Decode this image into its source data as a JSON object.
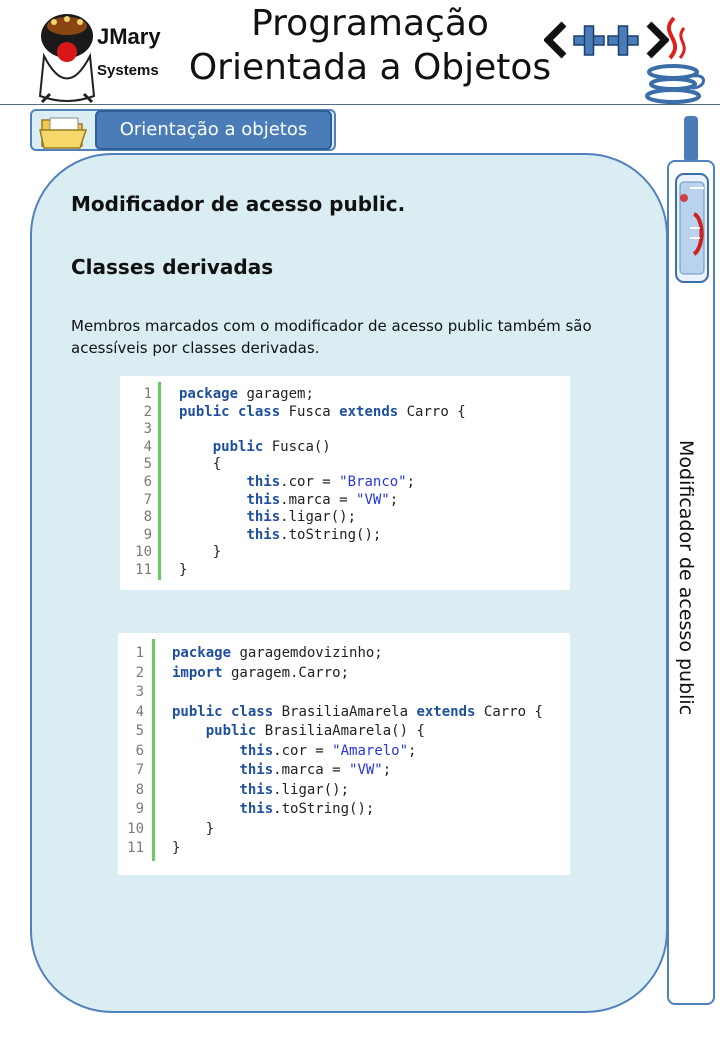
{
  "header": {
    "logo_name": "JMary",
    "logo_sub": "Systems",
    "title_line1": "Programação",
    "title_line2": "Orientada a Objetos",
    "cpp_logo": "<++>"
  },
  "tab": {
    "label": "Orientação a objetos"
  },
  "content": {
    "heading1": "Modificador de acesso public.",
    "heading2": "Classes derivadas",
    "paragraph": "Membros marcados com o modificador de acesso public também são acessíveis por classes derivadas."
  },
  "sidebar": {
    "vertical_title": "Modificador de acesso public"
  },
  "code_blocks": [
    {
      "lines": [
        [
          [
            "kw",
            "package"
          ],
          [
            "tx",
            " garagem;"
          ]
        ],
        [
          [
            "kw",
            "public class"
          ],
          [
            "tx",
            " Fusca "
          ],
          [
            "kw",
            "extends"
          ],
          [
            "tx",
            " Carro {"
          ]
        ],
        [],
        [
          [
            "tx",
            "    "
          ],
          [
            "kw",
            "public"
          ],
          [
            "tx",
            " Fusca()"
          ]
        ],
        [
          [
            "tx",
            "    {"
          ]
        ],
        [
          [
            "tx",
            "        "
          ],
          [
            "kw",
            "this"
          ],
          [
            "tx",
            ".cor = "
          ],
          [
            "str",
            "\"Branco\""
          ],
          [
            "tx",
            ";"
          ]
        ],
        [
          [
            "tx",
            "        "
          ],
          [
            "kw",
            "this"
          ],
          [
            "tx",
            ".marca = "
          ],
          [
            "str",
            "\"VW\""
          ],
          [
            "tx",
            ";"
          ]
        ],
        [
          [
            "tx",
            "        "
          ],
          [
            "kw",
            "this"
          ],
          [
            "tx",
            ".ligar();"
          ]
        ],
        [
          [
            "tx",
            "        "
          ],
          [
            "kw",
            "this"
          ],
          [
            "tx",
            ".toString();"
          ]
        ],
        [
          [
            "tx",
            "    }"
          ]
        ],
        [
          [
            "tx",
            "}"
          ]
        ]
      ]
    },
    {
      "lines": [
        [
          [
            "kw",
            "package"
          ],
          [
            "tx",
            " garagemdovizinho;"
          ]
        ],
        [
          [
            "kw",
            "import"
          ],
          [
            "tx",
            " garagem.Carro;"
          ]
        ],
        [],
        [
          [
            "kw",
            "public class"
          ],
          [
            "tx",
            " BrasiliaAmarela "
          ],
          [
            "kw",
            "extends"
          ],
          [
            "tx",
            " Carro {"
          ]
        ],
        [
          [
            "tx",
            "    "
          ],
          [
            "kw",
            "public"
          ],
          [
            "tx",
            " BrasiliaAmarela() {"
          ]
        ],
        [
          [
            "tx",
            "        "
          ],
          [
            "kw",
            "this"
          ],
          [
            "tx",
            ".cor = "
          ],
          [
            "str",
            "\"Amarelo\""
          ],
          [
            "tx",
            ";"
          ]
        ],
        [
          [
            "tx",
            "        "
          ],
          [
            "kw",
            "this"
          ],
          [
            "tx",
            ".marca = "
          ],
          [
            "str",
            "\"VW\""
          ],
          [
            "tx",
            ";"
          ]
        ],
        [
          [
            "tx",
            "        "
          ],
          [
            "kw",
            "this"
          ],
          [
            "tx",
            ".ligar();"
          ]
        ],
        [
          [
            "tx",
            "        "
          ],
          [
            "kw",
            "this"
          ],
          [
            "tx",
            ".toString();"
          ]
        ],
        [
          [
            "tx",
            "    }"
          ]
        ],
        [
          [
            "tx",
            "}"
          ]
        ]
      ]
    }
  ],
  "colors": {
    "accent": "#4f81bd",
    "panel_bg": "#daedf3",
    "keyword": "#1f4f9f",
    "string": "#2a37d8",
    "gutter": "#66cc66"
  }
}
